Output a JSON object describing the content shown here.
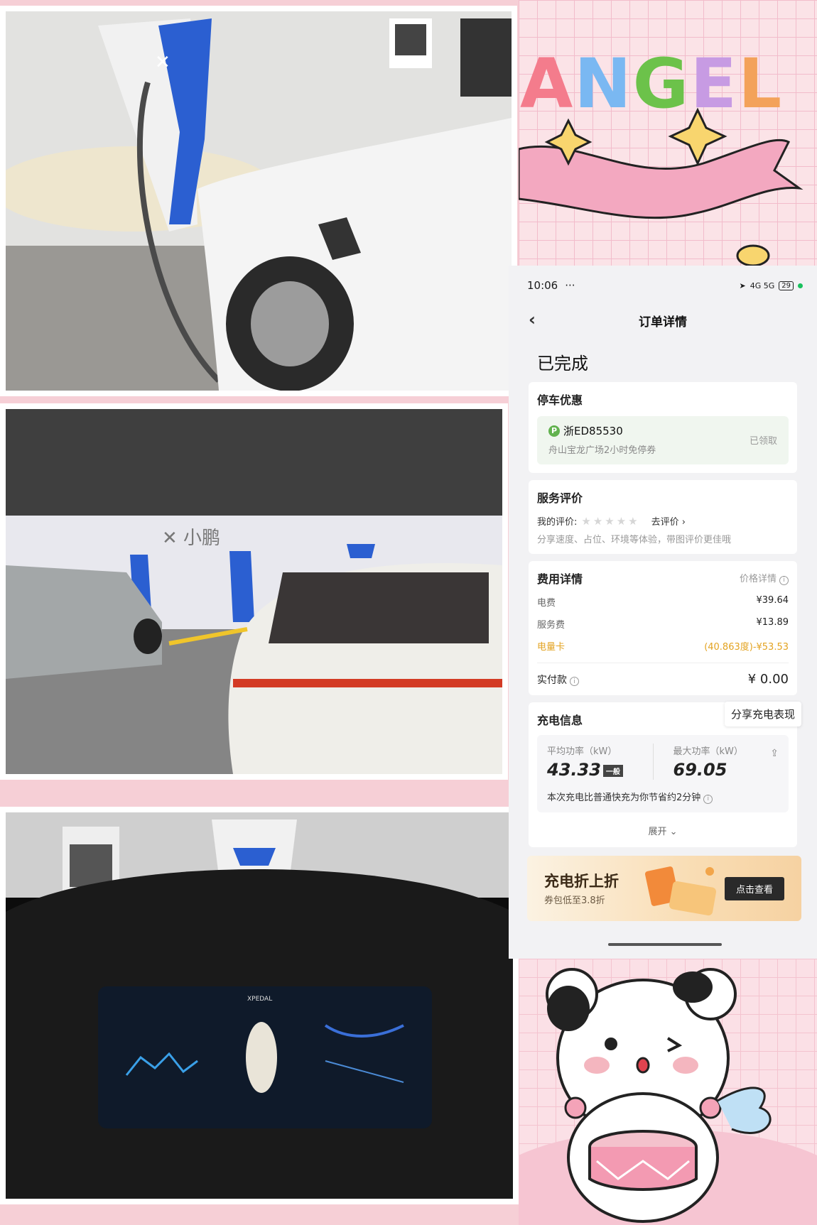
{
  "sticker_top": {
    "word_letters": [
      "A",
      "N",
      "G",
      "E",
      "L"
    ],
    "letter_colors": [
      "#f47c8c",
      "#7ab8f2",
      "#6cc24a",
      "#c79be3",
      "#f3a25a"
    ]
  },
  "dashboard_photo": {
    "brand": "XPEDAL"
  },
  "phone": {
    "status_bar": {
      "time": "10:06",
      "more": "···",
      "signal": "4G 5G",
      "battery": "29"
    },
    "nav": {
      "back": "‹",
      "title": "订单详情"
    },
    "order_status": "已完成",
    "parking": {
      "title": "停车优惠",
      "plate": "浙ED85530",
      "badge": "P",
      "desc": "舟山宝龙广场2小时免停券",
      "state": "已领取"
    },
    "rating": {
      "title": "服务评价",
      "my_rating_label": "我的评价:",
      "stars": "★★★★★",
      "go_rate": "去评价 ›",
      "hint": "分享速度、占位、环境等体验，带图评价更佳哦"
    },
    "fees": {
      "title": "费用详情",
      "price_detail": "价格详情",
      "rows": [
        {
          "label": "电费",
          "value": "¥39.64"
        },
        {
          "label": "服务费",
          "value": "¥13.89"
        },
        {
          "label": "电量卡",
          "value": "(40.863度)-¥53.53"
        }
      ],
      "total_label": "实付款",
      "total_value": "¥ 0.00"
    },
    "charging": {
      "title": "充电信息",
      "share_tip": "分享充电表现",
      "avg_label": "平均功率（kW）",
      "avg_value": "43.33",
      "avg_tag": "一般",
      "max_label": "最大功率（kW）",
      "max_value": "69.05",
      "saving": "本次充电比普通快充为你节省约2分钟",
      "expand": "展开 ⌄"
    },
    "promo": {
      "title": "充电折上折",
      "subtitle": "券包低至3.8折",
      "button": "点击查看"
    }
  },
  "colors": {
    "page_bg": "#f6cfd6",
    "accent_green": "#62b24f",
    "highlight_orange": "#e3a321"
  }
}
